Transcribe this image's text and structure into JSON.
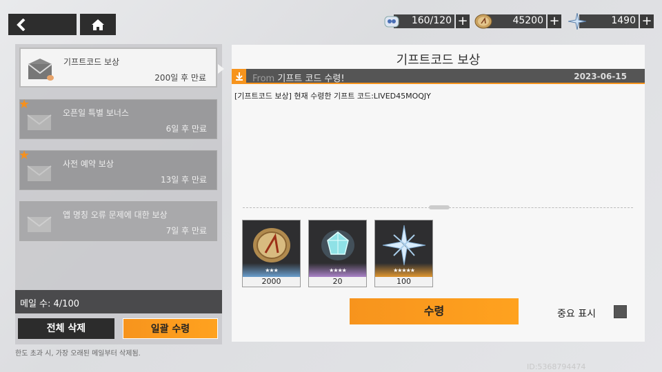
{
  "resources": [
    {
      "icon": "battery-icon",
      "value": "160/120"
    },
    {
      "icon": "coin-icon",
      "value": "45200"
    },
    {
      "icon": "crystal-icon",
      "value": "1490"
    }
  ],
  "plus_label": "+",
  "mail_list": [
    {
      "title": "기프트코드 보상",
      "expire": "200일 후 만료",
      "starred": false,
      "selected": true
    },
    {
      "title": "오픈일 특별 보너스",
      "expire": "6일 후 만료",
      "starred": true,
      "selected": false
    },
    {
      "title": "사전 예약 보상",
      "expire": "13일 후 만료",
      "starred": true,
      "selected": false
    },
    {
      "title": "앱 명칭 오류 문제에 대한 보상",
      "expire": "7일 후 만료",
      "starred": false,
      "selected": false
    }
  ],
  "mail_count": "메일 수: 4/100",
  "delete_all_label": "전체 삭제",
  "claim_all_label": "일괄 수령",
  "footnote": "한도 초과 시, 가장 오래된 메일부터 삭제됨.",
  "detail": {
    "title": "기프트코드 보상",
    "from_prefix": "From",
    "sender": "기프트 코드 수령!",
    "date": "2023-06-15",
    "body": "[기프트코드 보상] 현재 수령한 기프트 코드:LIVED45MOQJY",
    "rewards": [
      {
        "name": "coin",
        "icon": "coin-icon",
        "stars": "★★★",
        "qty": "2000",
        "glow": "#6fa8dc"
      },
      {
        "name": "gem",
        "icon": "gem-icon",
        "stars": "★★★★",
        "qty": "20",
        "glow": "#b58ad6"
      },
      {
        "name": "crystal",
        "icon": "crystal-icon",
        "stars": "★★★★★",
        "qty": "100",
        "glow": "#f0a030"
      }
    ],
    "claim_label": "수령",
    "important_label": "중요 표시"
  },
  "user_id": "ID:5368794474",
  "colors": {
    "accent": "#f7941d",
    "dark": "#2d2d2d"
  }
}
